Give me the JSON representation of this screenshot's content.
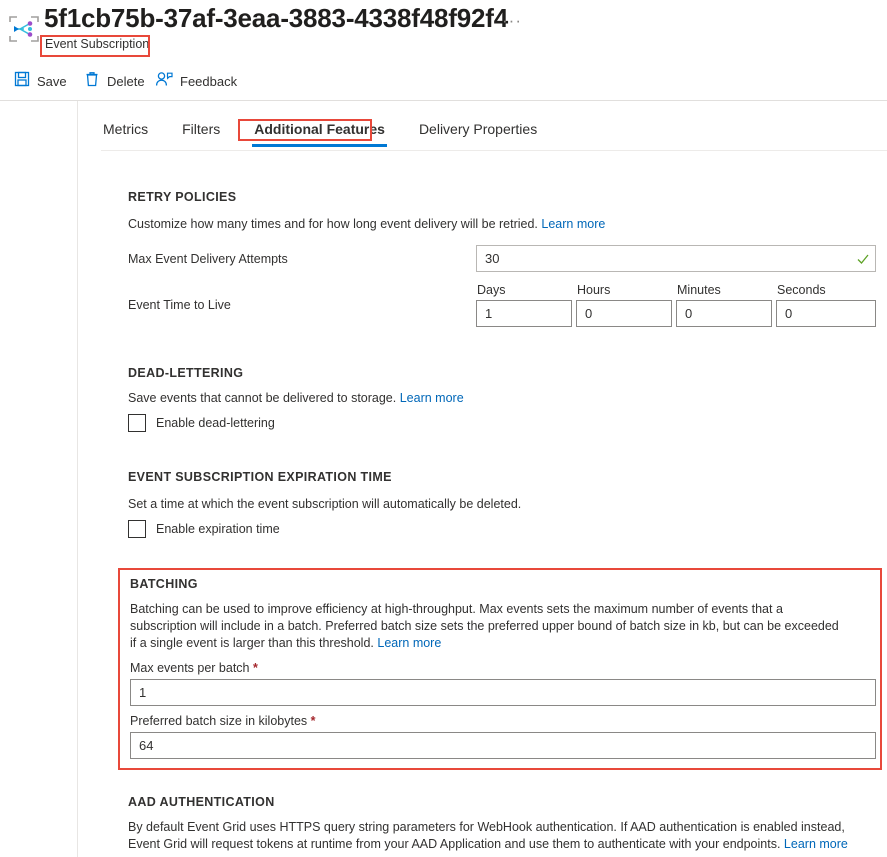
{
  "header": {
    "title": "5f1cb75b-37af-3eaa-3883-4338f48f92f4",
    "subtitle": "Event Subscription",
    "more_menu": "···",
    "icon": "event-grid-icon"
  },
  "commandbar": {
    "save": "Save",
    "delete": "Delete",
    "feedback": "Feedback"
  },
  "tabs": [
    {
      "label": "Metrics",
      "active": false
    },
    {
      "label": "Filters",
      "active": false
    },
    {
      "label": "Additional Features",
      "active": true
    },
    {
      "label": "Delivery Properties",
      "active": false
    }
  ],
  "retry_policies": {
    "heading": "RETRY POLICIES",
    "description": "Customize how many times and for how long event delivery will be retried.",
    "learn_more": "Learn more",
    "max_attempts_label": "Max Event Delivery Attempts",
    "max_attempts_value": "30",
    "ttl_label": "Event Time to Live",
    "ttl_fields": [
      {
        "label": "Days",
        "value": "1"
      },
      {
        "label": "Hours",
        "value": "0"
      },
      {
        "label": "Minutes",
        "value": "0"
      },
      {
        "label": "Seconds",
        "value": "0"
      }
    ]
  },
  "dead_lettering": {
    "heading": "DEAD-LETTERING",
    "description": "Save events that cannot be delivered to storage.",
    "learn_more": "Learn more",
    "checkbox_label": "Enable dead-lettering",
    "checked": false
  },
  "expiration": {
    "heading": "EVENT SUBSCRIPTION EXPIRATION TIME",
    "description": "Set a time at which the event subscription will automatically be deleted.",
    "checkbox_label": "Enable expiration time",
    "checked": false
  },
  "batching": {
    "heading": "BATCHING",
    "description": "Batching can be used to improve efficiency at high-throughput. Max events sets the maximum number of events that a subscription will include in a batch. Preferred batch size sets the preferred upper bound of batch size in kb, but can be exceeded if a single event is larger than this threshold.",
    "learn_more": "Learn more",
    "max_events_label": "Max events per batch",
    "max_events_value": "1",
    "batch_size_label": "Preferred batch size in kilobytes",
    "batch_size_value": "64",
    "required_marker": "*"
  },
  "aad": {
    "heading": "AAD AUTHENTICATION",
    "description": "By default Event Grid uses HTTPS query string parameters for WebHook authentication. If AAD authentication is enabled instead, Event Grid will request tokens at runtime from your AAD Application and use them to authenticate with your endpoints.",
    "learn_more": "Learn more"
  },
  "colors": {
    "accent": "#0078d4",
    "link": "#0067b8",
    "annotation": "#e8483a",
    "required": "#a4262c",
    "valid_check": "#5ea226"
  }
}
